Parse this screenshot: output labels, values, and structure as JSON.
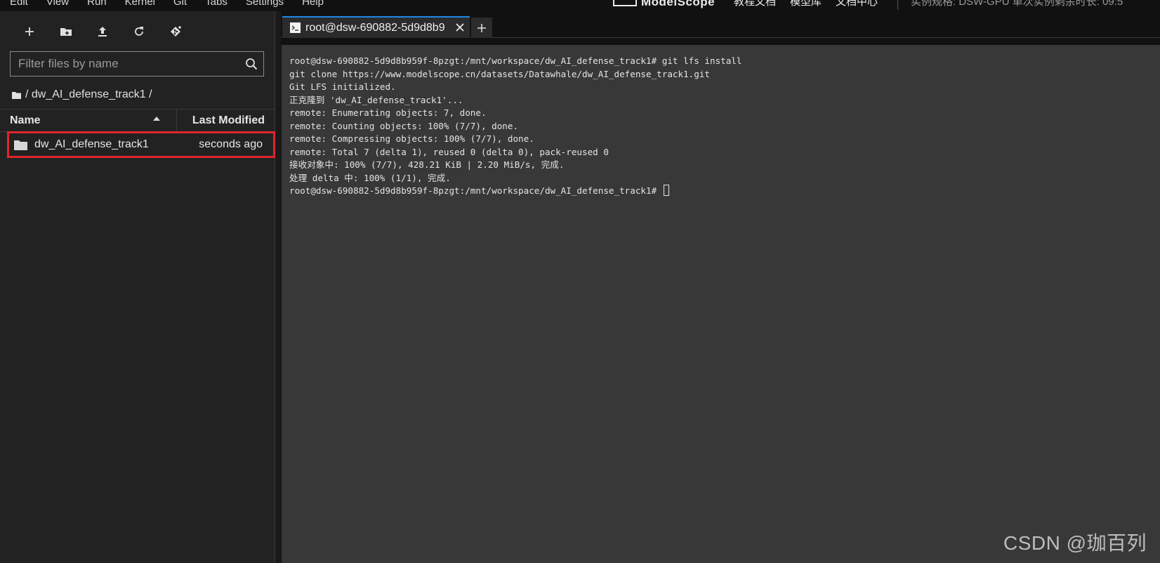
{
  "menubar": {
    "items": [
      "Edit",
      "View",
      "Run",
      "Kernel",
      "Git",
      "Tabs",
      "Settings",
      "Help"
    ],
    "brand": "ModelScope",
    "links": [
      "教程文档",
      "模型库",
      "文档中心"
    ],
    "instance_info": "实例规格: DSW-GPU   单次实例剩余时长: 09:5"
  },
  "file_browser": {
    "toolbar": {
      "new_launcher": "+",
      "new_folder": "new-folder",
      "upload": "upload",
      "refresh": "refresh",
      "git_clone": "git-clone"
    },
    "filter_placeholder": "Filter files by name",
    "breadcrumb": "/ dw_AI_defense_track1 /",
    "columns": {
      "name": "Name",
      "modified": "Last Modified"
    },
    "items": [
      {
        "name": "dw_AI_defense_track1",
        "modified": "seconds ago",
        "type": "folder"
      }
    ]
  },
  "tabs": [
    {
      "label": "root@dsw-690882-5d9d8b9",
      "active": true
    }
  ],
  "new_tab_label": "+",
  "terminal": {
    "lines": [
      "root@dsw-690882-5d9d8b959f-8pzgt:/mnt/workspace/dw_AI_defense_track1# git lfs install",
      "git clone https://www.modelscope.cn/datasets/Datawhale/dw_AI_defense_track1.git",
      "Git LFS initialized.",
      "正克隆到 'dw_AI_defense_track1'...",
      "remote: Enumerating objects: 7, done.",
      "remote: Counting objects: 100% (7/7), done.",
      "remote: Compressing objects: 100% (7/7), done.",
      "remote: Total 7 (delta 1), reused 0 (delta 0), pack-reused 0",
      "接收对象中: 100% (7/7), 428.21 KiB | 2.20 MiB/s, 完成.",
      "处理 delta 中: 100% (1/1), 完成."
    ],
    "prompt": "root@dsw-690882-5d9d8b959f-8pzgt:/mnt/workspace/dw_AI_defense_track1# "
  },
  "watermark": "CSDN @珈百列",
  "colors": {
    "highlight_border": "#e0262b",
    "active_tab_accent": "#1e88e5",
    "terminal_bg": "#383838"
  }
}
